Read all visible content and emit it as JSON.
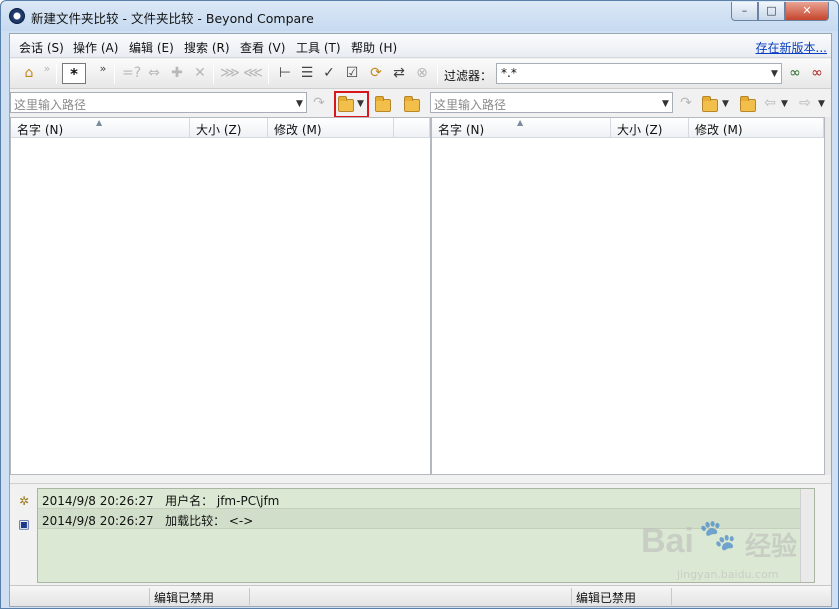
{
  "window": {
    "title": "新建文件夹比较 - 文件夹比较 - Beyond Compare",
    "minimize_glyph": "–",
    "maximize_glyph": "□",
    "close_glyph": "✕"
  },
  "menu": {
    "items": [
      {
        "label": "会话 (S)"
      },
      {
        "label": "操作 (A)"
      },
      {
        "label": "编辑 (E)"
      },
      {
        "label": "搜索 (R)"
      },
      {
        "label": "查看 (V)"
      },
      {
        "label": "工具 (T)"
      },
      {
        "label": "帮助 (H)"
      }
    ],
    "update_link": "存在新版本..."
  },
  "toolbar": {
    "home_glyph": "⌂",
    "chevron": "»",
    "star": "*",
    "filter_label": "过滤器：",
    "filter_value": "*.*",
    "icons": [
      {
        "name": "equal-diff",
        "glyph": "=?"
      },
      {
        "name": "swap",
        "glyph": "⇔"
      },
      {
        "name": "puzzle",
        "glyph": "✚"
      },
      {
        "name": "cross",
        "glyph": "✕"
      },
      {
        "name": "expand",
        "glyph": "⋙"
      },
      {
        "name": "collapse",
        "glyph": "⋘"
      },
      {
        "name": "tree",
        "glyph": "⊢"
      },
      {
        "name": "list",
        "glyph": "☰"
      },
      {
        "name": "check",
        "glyph": "✓"
      },
      {
        "name": "check-box",
        "glyph": "☑"
      },
      {
        "name": "folder-sync",
        "glyph": "⟳"
      },
      {
        "name": "swap-sides",
        "glyph": "⇄"
      },
      {
        "name": "stop",
        "glyph": "⊗"
      },
      {
        "name": "glasses",
        "glyph": "∞"
      },
      {
        "name": "glasses-off",
        "glyph": "∞"
      }
    ]
  },
  "paths": {
    "left_placeholder": "这里输入路径",
    "right_placeholder": "这里输入路径"
  },
  "columns": {
    "name": "名字 (N)",
    "size": "大小 (Z)",
    "modified": "修改 (M)"
  },
  "log": {
    "entries": [
      {
        "time": "2014/9/8 20:26:27",
        "message": "用户名： jfm-PC\\jfm"
      },
      {
        "time": "2014/9/8 20:26:27",
        "message": "加载比较： <->"
      }
    ]
  },
  "status": {
    "left": "编辑已禁用",
    "right": "编辑已禁用"
  },
  "watermark": {
    "brand": "Bai",
    "paw": "🐾",
    "suffix": "经验",
    "url": "jingyan.baidu.com"
  }
}
